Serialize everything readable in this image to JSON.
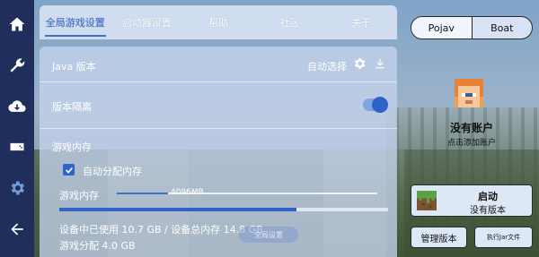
{
  "sidebar": {
    "items": [
      {
        "icon": "home-icon"
      },
      {
        "icon": "wrench-icon"
      },
      {
        "icon": "cloud-download-icon"
      },
      {
        "icon": "gamepad-icon"
      },
      {
        "icon": "gear-icon",
        "active": true
      },
      {
        "icon": "back-arrow-icon"
      }
    ]
  },
  "tabs": [
    {
      "label": "全局游戏设置",
      "active": true
    },
    {
      "label": "启动器设置"
    },
    {
      "label": "帮助"
    },
    {
      "label": "社区"
    },
    {
      "label": "关于"
    }
  ],
  "settings": {
    "java": {
      "label": "Java 版本",
      "value": "自动选择"
    },
    "isolation": {
      "label": "版本隔离",
      "enabled": true
    },
    "memory": {
      "section_label": "游戏内存",
      "auto_label": "自动分配内存",
      "auto_checked": true,
      "memory_label": "游戏内存",
      "memory_value": "4096MB",
      "usage_text": "设备中已使用 10.7 GB / 设备总内存 14.8 GB",
      "alloc_text": "游戏分配 4.0 GB",
      "ghost_button": "全局设置"
    }
  },
  "right": {
    "renderer_options": [
      "Pojav",
      "Boat"
    ],
    "renderer_selected": "Pojav",
    "account_title": "没有账户",
    "account_subtitle": "点击添加账户",
    "launch_title": "启动",
    "launch_subtitle": "没有版本",
    "manage_button": "管理版本",
    "jar_button": "执行Jar文件"
  },
  "colors": {
    "sidebar": "#1f2e5a",
    "accent": "#2f63c8",
    "tab_active": "#3e6fc9"
  }
}
